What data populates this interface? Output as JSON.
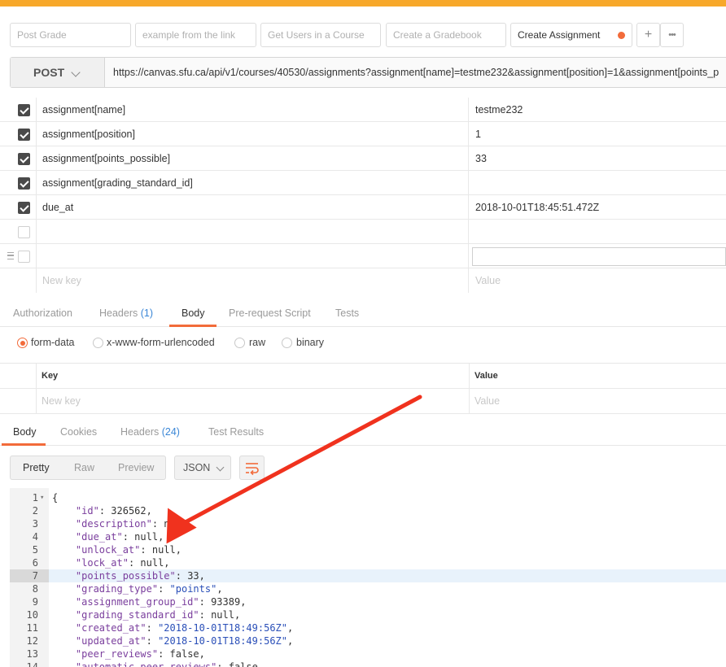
{
  "tabs": [
    {
      "label": "Post Grade",
      "active": false
    },
    {
      "label": "example from the link",
      "active": false
    },
    {
      "label": "Get Users in a Course",
      "active": false
    },
    {
      "label": "Create a Gradebook",
      "active": false
    },
    {
      "label": "Create Assignment",
      "active": true
    }
  ],
  "tab_actions": {
    "add": "+",
    "more": "•••"
  },
  "request": {
    "method": "POST",
    "url": "https://canvas.sfu.ca/api/v1/courses/40530/assignments?assignment[name]=testme232&assignment[position]=1&assignment[points_p"
  },
  "params": [
    {
      "key": "assignment[name]",
      "value": "testme232",
      "checked": true
    },
    {
      "key": "assignment[position]",
      "value": "1",
      "checked": true
    },
    {
      "key": "assignment[points_possible]",
      "value": "33",
      "checked": true
    },
    {
      "key": "assignment[grading_standard_id]",
      "value": "",
      "checked": true
    },
    {
      "key": "due_at",
      "value": "2018-10-01T18:45:51.472Z",
      "checked": true
    },
    {
      "key": "",
      "value": "",
      "checked": false
    },
    {
      "key": "",
      "value": "",
      "checked": false
    }
  ],
  "new_row": {
    "key_placeholder": "New key",
    "value_placeholder": "Value"
  },
  "request_tabs": {
    "authorization": "Authorization",
    "headers": "Headers",
    "headers_count": "(1)",
    "body": "Body",
    "prerequest": "Pre-request Script",
    "tests": "Tests"
  },
  "body_modes": {
    "form_data": "form-data",
    "urlencoded": "x-www-form-urlencoded",
    "raw": "raw",
    "binary": "binary"
  },
  "form_table": {
    "key_header": "Key",
    "value_header": "Value",
    "key_placeholder": "New key",
    "value_placeholder": "Value"
  },
  "response_tabs": {
    "body": "Body",
    "cookies": "Cookies",
    "headers": "Headers",
    "headers_count": "(24)",
    "test_results": "Test Results"
  },
  "response_toolbar": {
    "pretty": "Pretty",
    "raw": "Raw",
    "preview": "Preview",
    "format": "JSON"
  },
  "response_lines": [
    {
      "n": "1",
      "text": "{"
    },
    {
      "n": "2",
      "k": "\"id\"",
      "v": "326562",
      "t": "num"
    },
    {
      "n": "3",
      "k": "\"description\"",
      "v": "null",
      "t": "num"
    },
    {
      "n": "4",
      "k": "\"due_at\"",
      "v": "null",
      "t": "num"
    },
    {
      "n": "5",
      "k": "\"unlock_at\"",
      "v": "null",
      "t": "num"
    },
    {
      "n": "6",
      "k": "\"lock_at\"",
      "v": "null",
      "t": "num"
    },
    {
      "n": "7",
      "k": "\"points_possible\"",
      "v": "33",
      "t": "num"
    },
    {
      "n": "8",
      "k": "\"grading_type\"",
      "v": "\"points\"",
      "t": "str"
    },
    {
      "n": "9",
      "k": "\"assignment_group_id\"",
      "v": "93389",
      "t": "num"
    },
    {
      "n": "10",
      "k": "\"grading_standard_id\"",
      "v": "null",
      "t": "num"
    },
    {
      "n": "11",
      "k": "\"created_at\"",
      "v": "\"2018-10-01T18:49:56Z\"",
      "t": "str"
    },
    {
      "n": "12",
      "k": "\"updated_at\"",
      "v": "\"2018-10-01T18:49:56Z\"",
      "t": "str"
    },
    {
      "n": "13",
      "k": "\"peer_reviews\"",
      "v": "false",
      "t": "num"
    },
    {
      "n": "14",
      "k": "\"automatic_peer_reviews\"",
      "v": "false",
      "t": "num"
    }
  ],
  "colors": {
    "accent": "#f26b3a",
    "topbar": "#f7a82a",
    "arrow": "#f0321e",
    "count": "#3a86d6"
  }
}
